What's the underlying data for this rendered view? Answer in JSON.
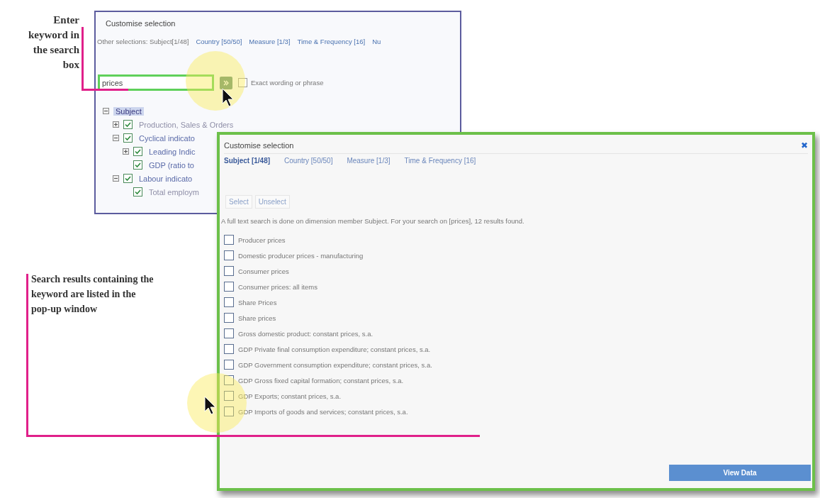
{
  "callouts": [
    {
      "text": "Enter keyword in the search box"
    },
    {
      "text": "Search results containing the keyword are listed in the pop-up window"
    }
  ],
  "back_panel": {
    "title": "Customise selection",
    "other_label": "Other selections: Subject[1/48]",
    "links": [
      "Country [50/50]",
      "Measure [1/3]",
      "Time & Frequency [16]",
      "Nu"
    ],
    "search": {
      "value": "prices"
    },
    "exact": {
      "label": "Exact wording or phrase",
      "checked": false
    },
    "tree": [
      {
        "label": "Subject",
        "expanded": true,
        "selected": true,
        "children": [
          {
            "kind": "group",
            "label": "Production, Sales & Orders",
            "expanded": false,
            "checked": true,
            "faded": true,
            "selected": false
          },
          {
            "kind": "group",
            "label": "Cyclical indicato",
            "expanded": true,
            "checked": true,
            "faded": false,
            "selected": false,
            "children": [
              {
                "kind": "group",
                "label": "Leading Indic",
                "expanded": false,
                "checked": true,
                "faded": false,
                "selected": false
              },
              {
                "kind": "leaf",
                "label": "GDP (ratio to",
                "checked": true,
                "faded": false,
                "selected": false
              }
            ]
          },
          {
            "kind": "group",
            "label": "Labour indicato",
            "expanded": true,
            "checked": true,
            "faded": false,
            "selected": false,
            "children": [
              {
                "kind": "leaf",
                "label": "Total employm",
                "checked": true,
                "faded": true,
                "selected": false
              }
            ]
          }
        ]
      }
    ]
  },
  "popup": {
    "title": "Customise selection",
    "close": "✖",
    "tabs": [
      {
        "label": "Subject [1/48]",
        "selected": true
      },
      {
        "label": "Country [50/50]",
        "selected": false
      },
      {
        "label": "Measure [1/3]",
        "selected": false
      },
      {
        "label": "Time & Frequency [16]",
        "selected": false
      }
    ],
    "buttons": [
      "Select",
      "Unselect"
    ],
    "info": "A full text search is done on dimension member Subject. For your search on [prices], 12 results found.",
    "results": [
      {
        "label": "Producer prices",
        "checked": false
      },
      {
        "label": "Domestic producer prices - manufacturing",
        "checked": false
      },
      {
        "label": "Consumer prices",
        "checked": false
      },
      {
        "label": "Consumer prices: all items",
        "checked": false
      },
      {
        "label": "Share Prices",
        "checked": false
      },
      {
        "label": "Share prices",
        "checked": false
      },
      {
        "label": "Gross domestic product: constant prices, s.a.",
        "checked": false
      },
      {
        "label": "GDP Private final consumption expenditure; constant prices, s.a.",
        "checked": false
      },
      {
        "label": "GDP Government consumption expenditure; constant prices, s.a.",
        "checked": false
      },
      {
        "label": "GDP Gross fixed capital formation; constant prices, s.a.",
        "checked": false
      },
      {
        "label": "GDP Exports; constant prices, s.a.",
        "checked": false
      },
      {
        "label": "GDP Imports of goods and services; constant prices, s.a.",
        "checked": false
      }
    ],
    "view_button": "View Data"
  }
}
